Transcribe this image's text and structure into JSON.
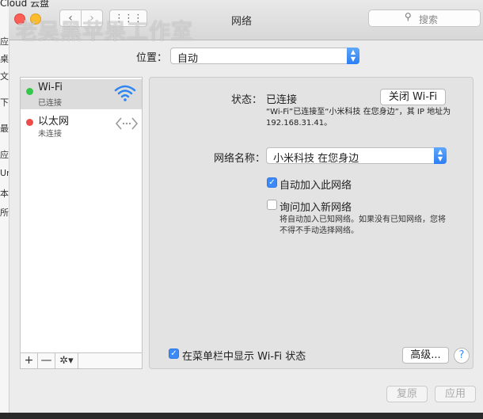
{
  "background_window": {
    "title": "Cloud 云盘",
    "sidebar_chars": [
      "应",
      "桌",
      "文",
      "下",
      "最",
      "应",
      "Ur",
      "本",
      "所"
    ]
  },
  "watermark": "老吴黑苹果工作室",
  "titlebar": {
    "title": "网络",
    "back_glyph": "‹",
    "forward_glyph": "›",
    "grid_glyph": "⋮⋮⋮",
    "search_placeholder": "搜索"
  },
  "location": {
    "label": "位置：",
    "value": "自动"
  },
  "services": [
    {
      "name": "Wi-Fi",
      "status": "已连接",
      "dot_color": "#34c84a",
      "icon": "wifi-icon",
      "selected": true
    },
    {
      "name": "以太网",
      "status": "未连接",
      "dot_color": "#ee4b4b",
      "icon": "ethernet-icon",
      "selected": false
    }
  ],
  "list_toolbar": {
    "add": "+",
    "remove": "—",
    "action": "✲▾"
  },
  "detail": {
    "status_label": "状态：",
    "status_value": "已连接",
    "wifi_off_button": "关闭 Wi-Fi",
    "status_desc": "“Wi-Fi”已连接至“小米科技 在您身边”，其 IP 地址为 192.168.31.41。",
    "network_name_label": "网络名称：",
    "network_name_value": "小米科技 在您身边",
    "auto_join_label": "自动加入此网络",
    "auto_join_checked": true,
    "ask_join_label": "询问加入新网络",
    "ask_join_checked": false,
    "ask_join_desc": "将自动加入已知网络。如果没有已知网络，您将不得不手动选择网络。",
    "show_menubar_label": "在菜单栏中显示 Wi-Fi 状态",
    "show_menubar_checked": true,
    "advanced_button": "高级...",
    "help_button": "?"
  },
  "footer": {
    "revert_button": "复原",
    "apply_button": "应用"
  },
  "colors": {
    "accent": "#3b8af7",
    "close": "#fd5f57",
    "minimize": "#fdbc2e"
  }
}
